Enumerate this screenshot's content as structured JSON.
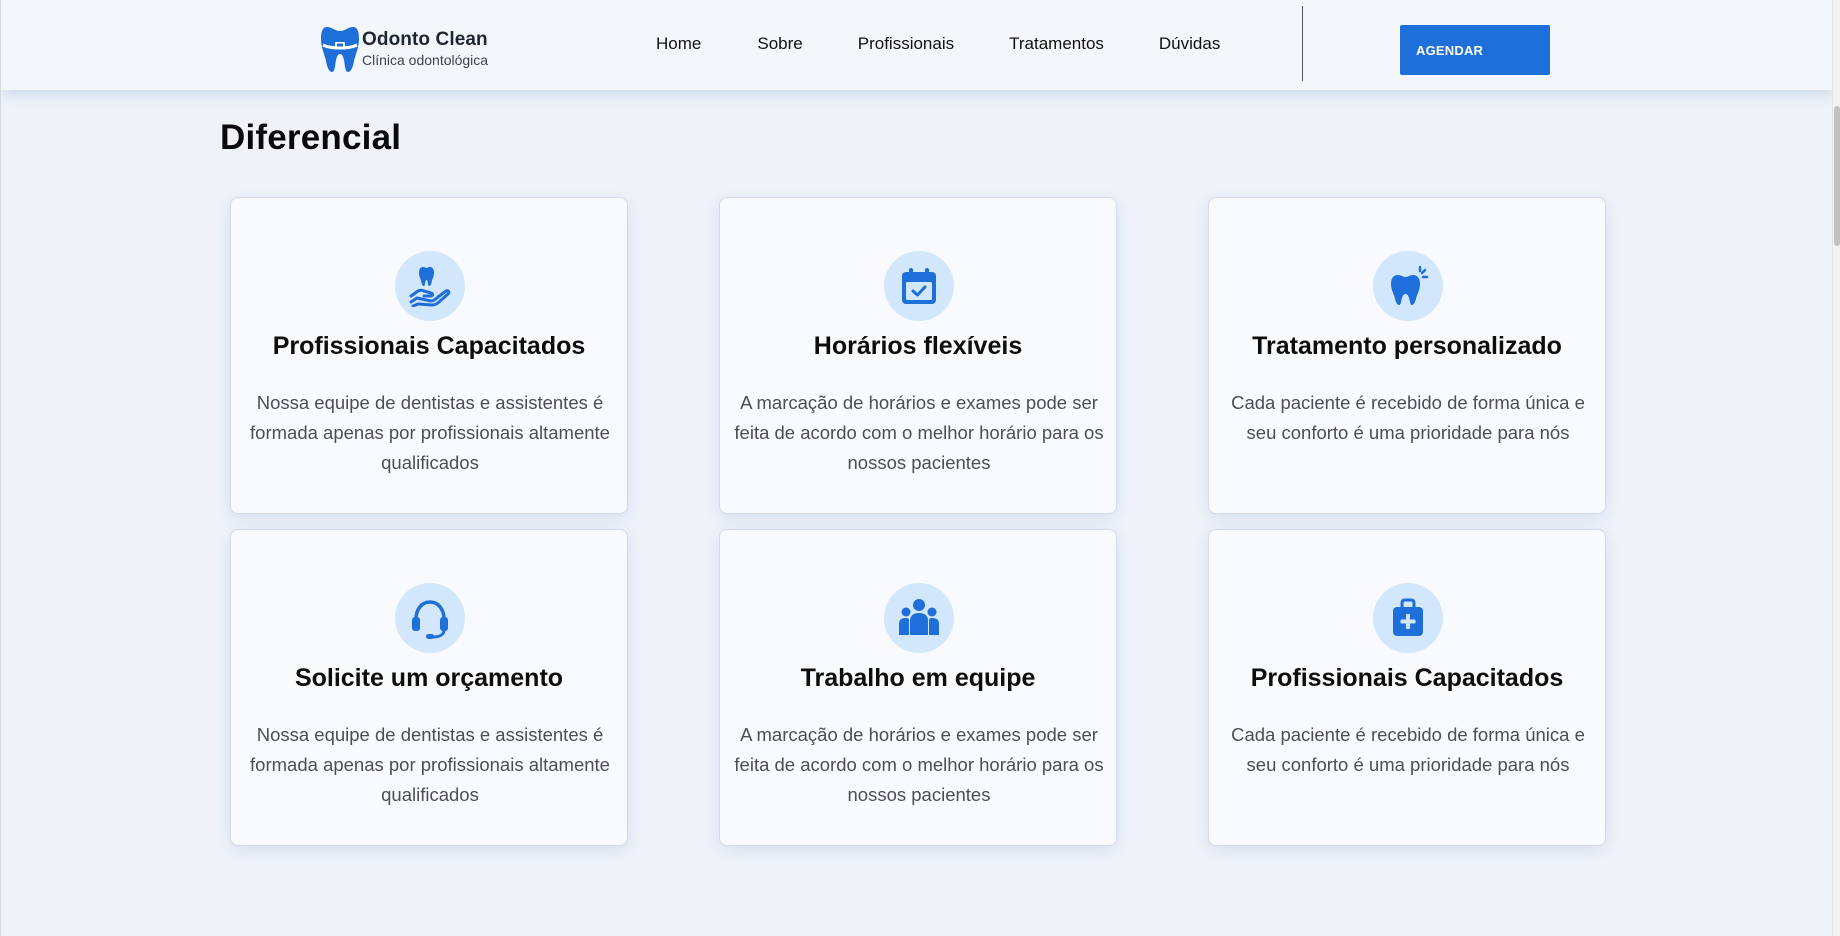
{
  "header": {
    "brand_title": "Odonto Clean",
    "brand_subtitle": "Clínica odontológica",
    "nav": [
      "Home",
      "Sobre",
      "Profissionais",
      "Tratamentos",
      "Dúvidas"
    ],
    "cta_label": "AGENDAR"
  },
  "colors": {
    "primary": "#1e6fd9",
    "icon_bg": "#d3e7fc",
    "page_bg": "#eff3f9",
    "card_bg": "#f8fafd"
  },
  "section": {
    "title": "Diferencial",
    "cards": [
      {
        "icon": "hand-tooth-icon",
        "title": "Profissionais Capacitados",
        "text": "Nossa equipe de dentistas e assistentes é formada apenas por profissionais altamente qualificados"
      },
      {
        "icon": "calendar-check-icon",
        "title": "Horários flexíveis",
        "text": "A marcação de horários e exames pode ser feita de acordo com o melhor horário para os nossos pacientes"
      },
      {
        "icon": "sparkle-tooth-icon",
        "title": "Tratamento personalizado",
        "text": "Cada paciente é recebido de forma única e seu conforto é uma prioridade para nós"
      },
      {
        "icon": "headset-icon",
        "title": "Solicite um orçamento",
        "text": "Nossa equipe de dentistas e assistentes é formada apenas por profissionais altamente qualificados"
      },
      {
        "icon": "team-icon",
        "title": "Trabalho em equipe",
        "text": "A marcação de horários e exames pode ser feita de acordo com o melhor horário para os nossos pacientes"
      },
      {
        "icon": "medical-kit-icon",
        "title": "Profissionais Capacitados",
        "text": "Cada paciente é recebido de forma única e seu conforto é uma prioridade para nós"
      }
    ]
  }
}
